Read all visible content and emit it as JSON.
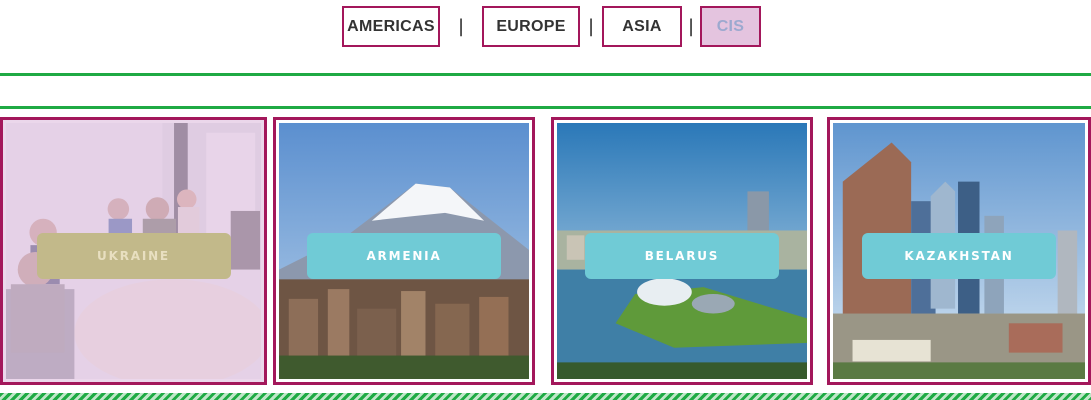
{
  "tabs": [
    {
      "label": "AMERICAS",
      "active": false
    },
    {
      "label": "EUROPE",
      "active": false
    },
    {
      "label": "ASIA",
      "active": false
    },
    {
      "label": "CIS",
      "active": true
    }
  ],
  "separator": "|",
  "cards": [
    {
      "label": "UKRAINE",
      "image": "office-team-photo",
      "dimmed": true
    },
    {
      "label": "ARMENIA",
      "image": "mountain-city-photo",
      "dimmed": false
    },
    {
      "label": "BELARUS",
      "image": "river-city-photo",
      "dimmed": false
    },
    {
      "label": "KAZAKHSTAN",
      "image": "skyscraper-city-photo",
      "dimmed": false
    }
  ],
  "colors": {
    "accent_border": "#a3175b",
    "rule_green": "#1faa44",
    "button_teal": "#70cbd6",
    "active_tab_bg": "#e4c4df"
  }
}
